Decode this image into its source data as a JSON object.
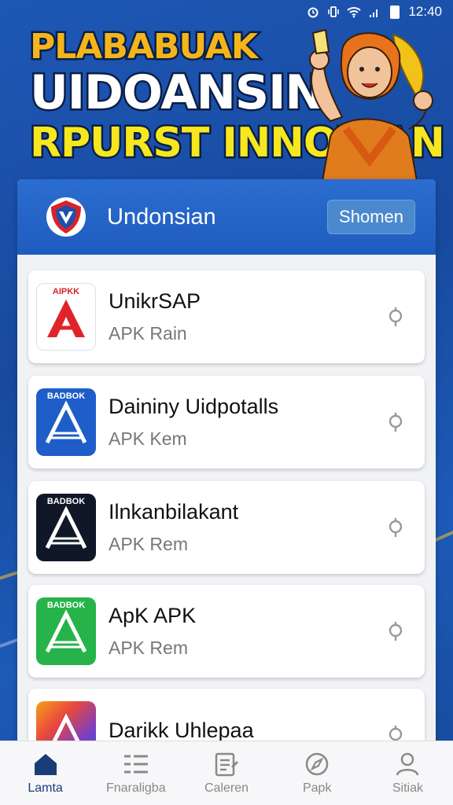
{
  "status_bar": {
    "time": "12:40",
    "icons": [
      "alarm-icon",
      "vibrate-icon",
      "wifi-icon",
      "signal-icon",
      "battery-icon"
    ]
  },
  "hero": {
    "line1": "PLABABUAK",
    "line2": "UIDOANSIN",
    "line3": "RPURST INNOWAN"
  },
  "card": {
    "title": "Undonsian",
    "header_button": "Shomen",
    "logo_icon": "shield-emblem-icon"
  },
  "apps": [
    {
      "title": "UnikrSAP",
      "subtitle": "APK Rain",
      "icon_badge": "AIPKK",
      "icon_color": "#e0232b",
      "icon_bg": "#ffffff"
    },
    {
      "title": "Daininy Uidpotalls",
      "subtitle": "APK Kem",
      "icon_badge": "BADBOK",
      "icon_color": "#ffffff",
      "icon_bg": "#1f5ec9"
    },
    {
      "title": "Ilnkanbilakant",
      "subtitle": "APK Rem",
      "icon_badge": "BADBOK",
      "icon_color": "#ffffff",
      "icon_bg": "#101828"
    },
    {
      "title": "ApK APK",
      "subtitle": "APK Rem",
      "icon_badge": "BADBOK",
      "icon_color": "#ffffff",
      "icon_bg": "#25b34a"
    },
    {
      "title": "Darikk Uhlepaa",
      "subtitle": "",
      "icon_badge": "",
      "icon_color": "#ffffff",
      "icon_bg": "#e8473e"
    }
  ],
  "nav": [
    {
      "label": "Lamta",
      "icon": "home-icon",
      "active": true
    },
    {
      "label": "Fnaraligba",
      "icon": "list-icon",
      "active": false
    },
    {
      "label": "Caleren",
      "icon": "document-icon",
      "active": false
    },
    {
      "label": "Papk",
      "icon": "compass-icon",
      "active": false
    },
    {
      "label": "Sitiak",
      "icon": "profile-icon",
      "active": false
    }
  ],
  "colors": {
    "background": "#1e57b5",
    "card_header": "#2b6dd0",
    "hero_line1": "#f5b51a",
    "hero_line3": "#f6e71e"
  }
}
